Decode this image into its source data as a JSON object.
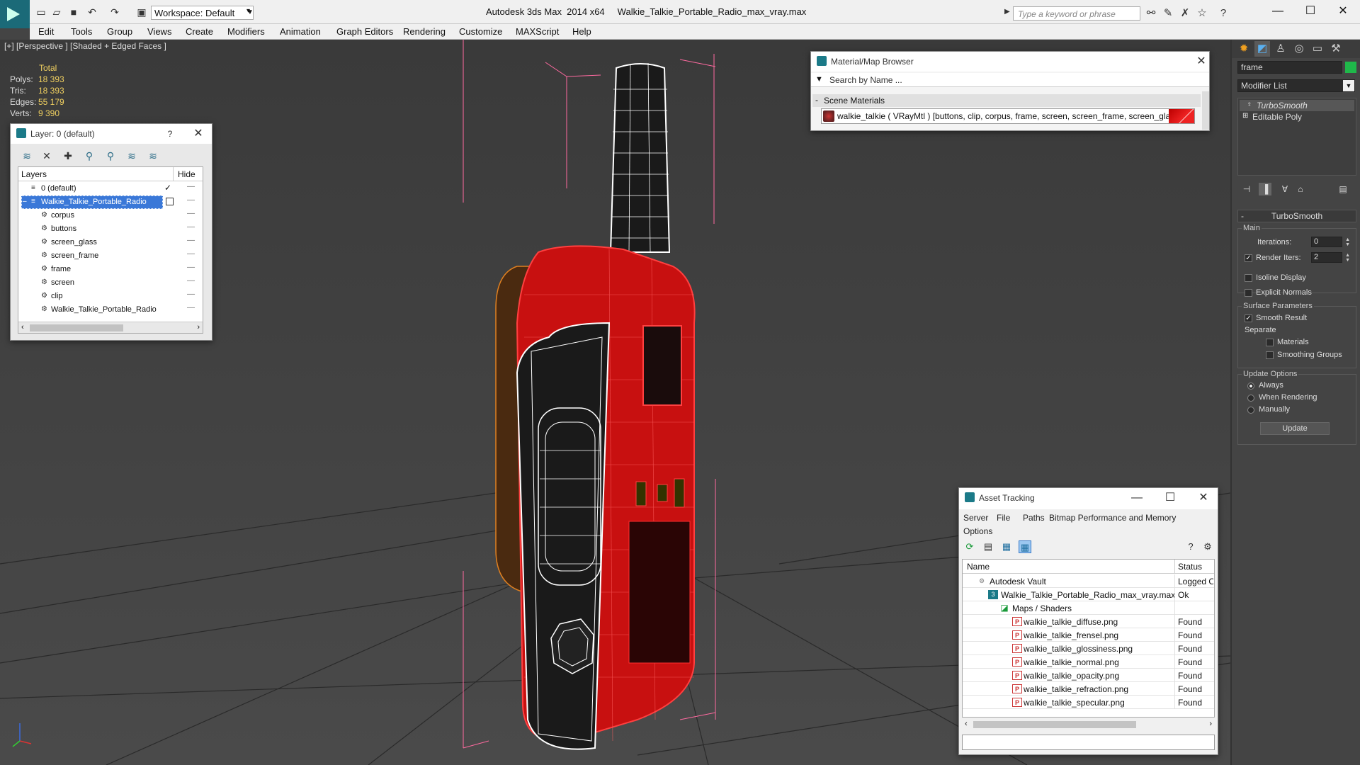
{
  "titlebar": {
    "workspace": "Workspace: Default",
    "app_name": "Autodesk 3ds Max  2014 x64",
    "file_name": "Walkie_Talkie_Portable_Radio_max_vray.max",
    "search_placeholder": "Type a keyword or phrase"
  },
  "menu": [
    "Edit",
    "Tools",
    "Group",
    "Views",
    "Create",
    "Modifiers",
    "Animation",
    "Graph Editors",
    "Rendering",
    "Customize",
    "MAXScript",
    "Help"
  ],
  "viewport": {
    "label": "[+] [Perspective ] [Shaded + Edged Faces ]",
    "stats": {
      "total_label": "Total",
      "rows": [
        {
          "key": "Polys:",
          "value": "18 393"
        },
        {
          "key": "Tris:",
          "value": "18 393"
        },
        {
          "key": "Edges:",
          "value": "55 179"
        },
        {
          "key": "Verts:",
          "value": "9 390"
        }
      ]
    }
  },
  "layer_panel": {
    "title": "Layer: 0 (default)",
    "help": "?",
    "header_layers": "Layers",
    "header_hide": "Hide",
    "rows": [
      {
        "name": "0 (default)",
        "level": 0,
        "checked": true
      },
      {
        "name": "Walkie_Talkie_Portable_Radio",
        "level": 0,
        "selected": true
      },
      {
        "name": "corpus",
        "level": 1
      },
      {
        "name": "buttons",
        "level": 1
      },
      {
        "name": "screen_glass",
        "level": 1
      },
      {
        "name": "screen_frame",
        "level": 1
      },
      {
        "name": "frame",
        "level": 1
      },
      {
        "name": "screen",
        "level": 1
      },
      {
        "name": "clip",
        "level": 1
      },
      {
        "name": "Walkie_Talkie_Portable_Radio",
        "level": 1
      }
    ]
  },
  "material_browser": {
    "title": "Material/Map Browser",
    "search_placeholder": "Search by Name ...",
    "section": "Scene Materials",
    "material": "walkie_talkie  ( VRayMtl ) [buttons, clip, corpus, frame, screen, screen_frame, screen_glass]"
  },
  "asset_tracking": {
    "title": "Asset Tracking",
    "menu": [
      "Server",
      "File",
      "Paths",
      "Bitmap Performance and Memory",
      "Options"
    ],
    "col_name": "Name",
    "col_status": "Status",
    "rows": [
      {
        "name": "Autodesk Vault",
        "status": "Logged Out",
        "level": 1,
        "icon": "vault"
      },
      {
        "name": "Walkie_Talkie_Portable_Radio_max_vray.max",
        "status": "Ok",
        "level": 2,
        "icon": "max"
      },
      {
        "name": "Maps / Shaders",
        "status": "",
        "level": 3,
        "icon": "maps"
      },
      {
        "name": "walkie_talkie_diffuse.png",
        "status": "Found",
        "level": 4,
        "icon": "png"
      },
      {
        "name": "walkie_talkie_frensel.png",
        "status": "Found",
        "level": 4,
        "icon": "png"
      },
      {
        "name": "walkie_talkie_glossiness.png",
        "status": "Found",
        "level": 4,
        "icon": "png"
      },
      {
        "name": "walkie_talkie_normal.png",
        "status": "Found",
        "level": 4,
        "icon": "png"
      },
      {
        "name": "walkie_talkie_opacity.png",
        "status": "Found",
        "level": 4,
        "icon": "png"
      },
      {
        "name": "walkie_talkie_refraction.png",
        "status": "Found",
        "level": 4,
        "icon": "png"
      },
      {
        "name": "walkie_talkie_specular.png",
        "status": "Found",
        "level": 4,
        "icon": "png"
      }
    ]
  },
  "command_panel": {
    "object_name": "frame",
    "modifier_list": "Modifier List",
    "stack": [
      {
        "name": "TurboSmooth",
        "active": true
      },
      {
        "name": "Editable Poly",
        "active": false
      }
    ],
    "turbosmooth": {
      "title": "TurboSmooth",
      "main": "Main",
      "iterations_label": "Iterations:",
      "iterations": "0",
      "render_iters_label": "Render Iters:",
      "render_iters": "2",
      "isoline": "Isoline Display",
      "explicit_normals": "Explicit Normals",
      "surface_params": "Surface Parameters",
      "smooth_result": "Smooth Result",
      "separate": "Separate",
      "materials": "Materials",
      "smoothing_groups": "Smoothing Groups",
      "update_options": "Update Options",
      "always": "Always",
      "when_rendering": "When Rendering",
      "manually": "Manually",
      "update": "Update"
    }
  }
}
